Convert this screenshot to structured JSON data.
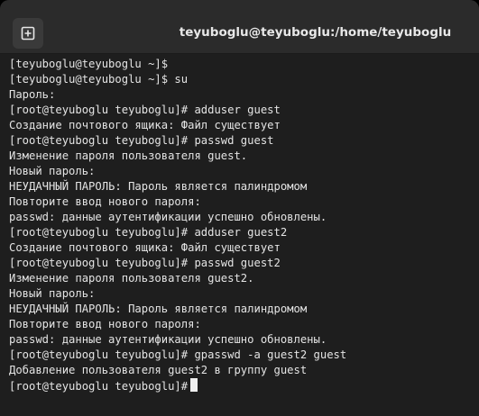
{
  "window": {
    "title": "teyuboglu@teyuboglu:/home/teyuboglu"
  },
  "toolbar": {
    "new_tab_icon": "new-tab-plus-icon"
  },
  "terminal": {
    "lines": [
      "[teyuboglu@teyuboglu ~]$",
      "[teyuboglu@teyuboglu ~]$ su",
      "Пароль:",
      "[root@teyuboglu teyuboglu]# adduser guest",
      "Создание почтового ящика: Файл существует",
      "[root@teyuboglu teyuboglu]# passwd guest",
      "Изменение пароля пользователя guest.",
      "Новый пароль:",
      "НЕУДАЧНЫЙ ПАРОЛЬ: Пароль является палиндромом",
      "Повторите ввод нового пароля:",
      "passwd: данные аутентификации успешно обновлены.",
      "[root@teyuboglu teyuboglu]# adduser guest2",
      "Создание почтового ящика: Файл существует",
      "[root@teyuboglu teyuboglu]# passwd guest2",
      "Изменение пароля пользователя guest2.",
      "Новый пароль:",
      "НЕУДАЧНЫЙ ПАРОЛЬ: Пароль является палиндромом",
      "Повторите ввод нового пароля:",
      "passwd: данные аутентификации успешно обновлены.",
      "[root@teyuboglu teyuboglu]# gpasswd -a guest2 guest",
      "Добавление пользователя guest2 в группу guest",
      "[root@teyuboglu teyuboglu]#"
    ]
  },
  "colors": {
    "background": "#1e1e1e",
    "titlebar": "#2b2b2b",
    "text": "#e4e4e4"
  }
}
